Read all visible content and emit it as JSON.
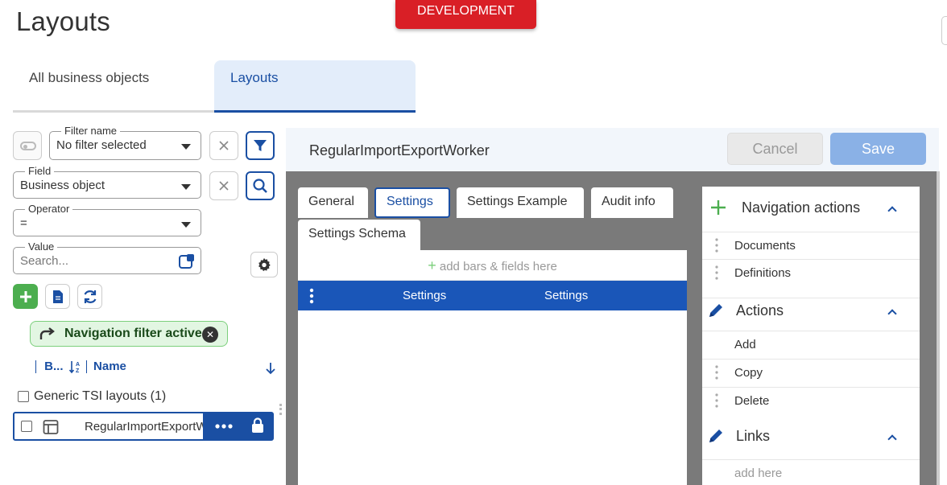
{
  "page": {
    "title": "Layouts",
    "env_badge": "DEVELOPMENT"
  },
  "top_tabs": [
    {
      "label": "All business objects",
      "active": false
    },
    {
      "label": "Layouts",
      "active": true
    }
  ],
  "filter": {
    "filter_name": {
      "label": "Filter name",
      "value": "No filter selected"
    },
    "field": {
      "label": "Field",
      "value": "Business object"
    },
    "operator": {
      "label": "Operator",
      "value": "="
    },
    "value": {
      "label": "Value",
      "placeholder": "Search..."
    },
    "nav_chip": "Navigation filter active"
  },
  "list": {
    "col_b": "B...",
    "col_name": "Name",
    "group": "Generic TSI layouts (1)",
    "selected_item": "RegularImportExportWorker"
  },
  "main": {
    "title": "RegularImportExportWorker",
    "cancel_label": "Cancel",
    "save_label": "Save",
    "tabs": [
      {
        "label": "General"
      },
      {
        "label": "Settings"
      },
      {
        "label": "Settings Example"
      },
      {
        "label": "Audit info"
      },
      {
        "label": "Settings Schema"
      }
    ],
    "add_bars": "add bars & fields here",
    "bar_col1": "Settings",
    "bar_col2": "Settings"
  },
  "side": {
    "nav_actions": {
      "title": "Navigation actions",
      "items": [
        "Documents",
        "Definitions"
      ]
    },
    "actions": {
      "title": "Actions",
      "items": [
        "Add",
        "Copy",
        "Delete"
      ]
    },
    "links": {
      "title": "Links",
      "placeholder": "add here"
    }
  },
  "colors": {
    "accent": "#1a4fa3",
    "dev_red": "#d91f26",
    "green": "#4cae4f",
    "save": "#8ab1e6"
  }
}
